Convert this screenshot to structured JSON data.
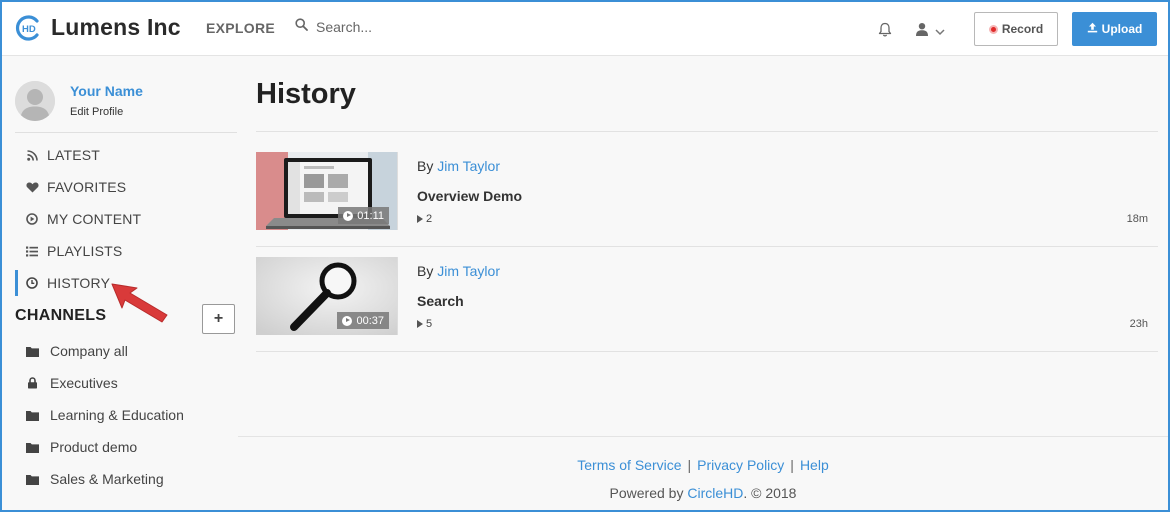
{
  "brand": {
    "name": "Lumens Inc",
    "mark_text": "HD",
    "accent": "#3b8fd6"
  },
  "header": {
    "explore_label": "EXPLORE",
    "search_placeholder": "Search...",
    "record_label": "Record",
    "upload_label": "Upload",
    "icons": [
      "search-icon",
      "bell-icon",
      "user-icon",
      "chevron-down-icon",
      "record-icon",
      "upload-icon"
    ]
  },
  "profile": {
    "name": "Your Name",
    "edit_label": "Edit Profile"
  },
  "nav": {
    "items": [
      {
        "label": "LATEST",
        "icon": "rss-icon"
      },
      {
        "label": "FAVORITES",
        "icon": "heart-icon"
      },
      {
        "label": "MY CONTENT",
        "icon": "play-circle-icon"
      },
      {
        "label": "PLAYLISTS",
        "icon": "list-icon"
      },
      {
        "label": "HISTORY",
        "icon": "clock-icon",
        "active": true
      }
    ]
  },
  "channels": {
    "heading": "CHANNELS",
    "add_label": "+",
    "items": [
      {
        "label": "Company all",
        "icon": "folder-icon"
      },
      {
        "label": "Executives",
        "icon": "lock-icon"
      },
      {
        "label": "Learning & Education",
        "icon": "folder-icon"
      },
      {
        "label": "Product demo",
        "icon": "folder-icon"
      },
      {
        "label": "Sales & Marketing",
        "icon": "folder-icon"
      }
    ]
  },
  "main": {
    "title": "History",
    "videos": [
      {
        "by_prefix": "By",
        "author": "Jim Taylor",
        "title": "Overview Demo",
        "views": "2",
        "age": "18m",
        "duration": "01:11",
        "thumbnail": "laptop-screen"
      },
      {
        "by_prefix": "By",
        "author": "Jim Taylor",
        "title": "Search",
        "views": "5",
        "age": "23h",
        "duration": "00:37",
        "thumbnail": "magnifier"
      }
    ]
  },
  "footer": {
    "links": [
      "Terms of Service",
      "Privacy Policy",
      "Help"
    ],
    "powered_prefix": "Powered by",
    "powered_brand": "CircleHD",
    "powered_suffix": ". © 2018"
  },
  "annotation": {
    "type": "red-arrow",
    "points_to": "HISTORY",
    "color": "#d93a3a"
  }
}
